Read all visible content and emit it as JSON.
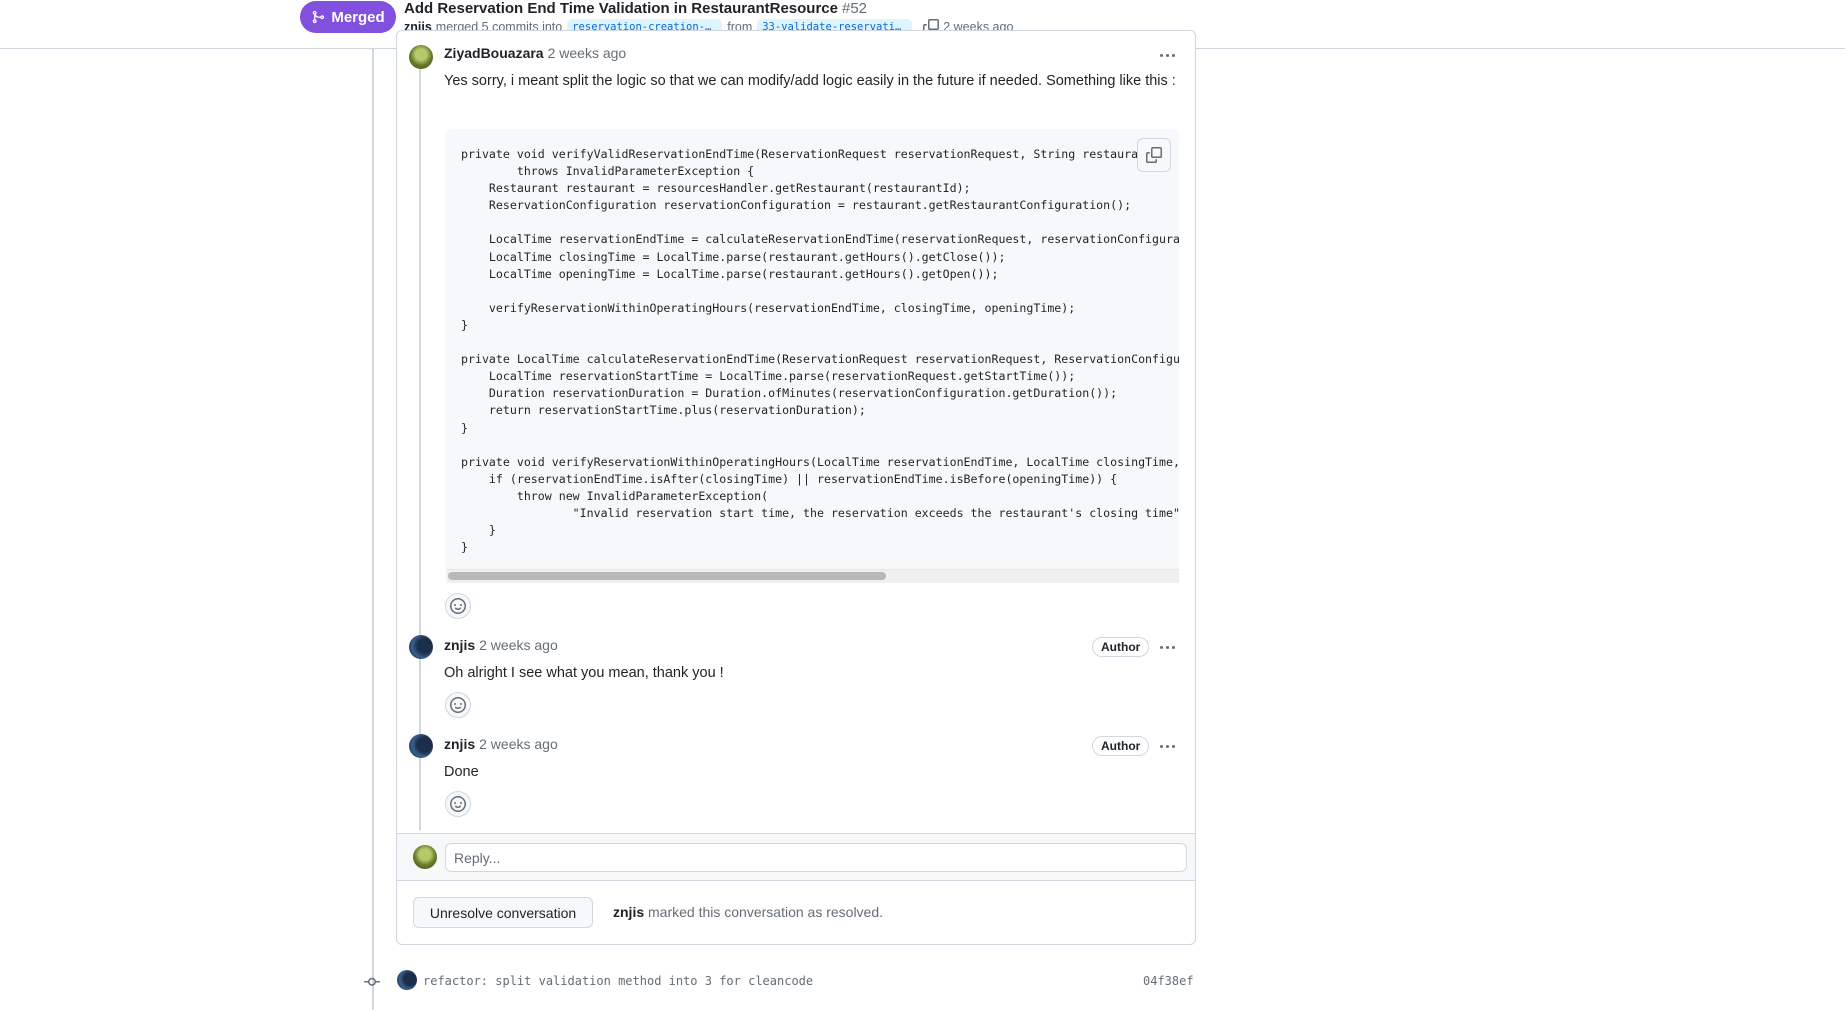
{
  "header": {
    "status_label": "Merged",
    "title": "Add Reservation End Time Validation in RestaurantResource",
    "number": "#52",
    "merge_author": "znjis",
    "merge_text": "merged 5 commits into",
    "base_branch": "reservation-creation-f…",
    "from_text": "from",
    "head_branch": "33-validate-reservatio…",
    "time": "2 weeks ago"
  },
  "thread": {
    "comments": [
      {
        "author": "ZiyadBouazara",
        "time": "2 weeks ago",
        "body": "Yes sorry, i meant split the logic so that we can modify/add logic easily in the future if needed. Something like this :",
        "code": "private void verifyValidReservationEndTime(ReservationRequest reservationRequest, String restaurantId)\n        throws InvalidParameterException {\n    Restaurant restaurant = resourcesHandler.getRestaurant(restaurantId);\n    ReservationConfiguration reservationConfiguration = restaurant.getRestaurantConfiguration();\n\n    LocalTime reservationEndTime = calculateReservationEndTime(reservationRequest, reservationConfiguration);\n    LocalTime closingTime = LocalTime.parse(restaurant.getHours().getClose());\n    LocalTime openingTime = LocalTime.parse(restaurant.getHours().getOpen());\n\n    verifyReservationWithinOperatingHours(reservationEndTime, closingTime, openingTime);\n}\n\nprivate LocalTime calculateReservationEndTime(ReservationRequest reservationRequest, ReservationConfiguration reservationConfiguration) {\n    LocalTime reservationStartTime = LocalTime.parse(reservationRequest.getStartTime());\n    Duration reservationDuration = Duration.ofMinutes(reservationConfiguration.getDuration());\n    return reservationStartTime.plus(reservationDuration);\n}\n\nprivate void verifyReservationWithinOperatingHours(LocalTime reservationEndTime, LocalTime closingTime, LocalTime openingTime) {\n    if (reservationEndTime.isAfter(closingTime) || reservationEndTime.isBefore(openingTime)) {\n        throw new InvalidParameterException(\n                \"Invalid reservation start time, the reservation exceeds the restaurant's closing time\");\n    }\n}"
      },
      {
        "author": "znjis",
        "time": "2 weeks ago",
        "badge": "Author",
        "body": "Oh alright I see what you mean, thank you !"
      },
      {
        "author": "znjis",
        "time": "2 weeks ago",
        "badge": "Author",
        "body": "Done"
      }
    ],
    "reply_placeholder": "Reply...",
    "unresolve_label": "Unresolve conversation",
    "resolved_by": "znjis",
    "resolved_text": "marked this conversation as resolved."
  },
  "commit": {
    "message": "refactor: split validation method into 3 for cleancode",
    "sha": "04f38ef"
  },
  "colors": {
    "merged": "#8250df",
    "branch_bg": "#ddf4ff",
    "link": "#0969da",
    "border": "#d0d7de"
  },
  "icons": {
    "merge": "git-merge-icon",
    "copy": "copy-icon",
    "more": "kebab-horizontal-icon",
    "smiley": "smiley-icon",
    "commit": "git-commit-icon"
  }
}
